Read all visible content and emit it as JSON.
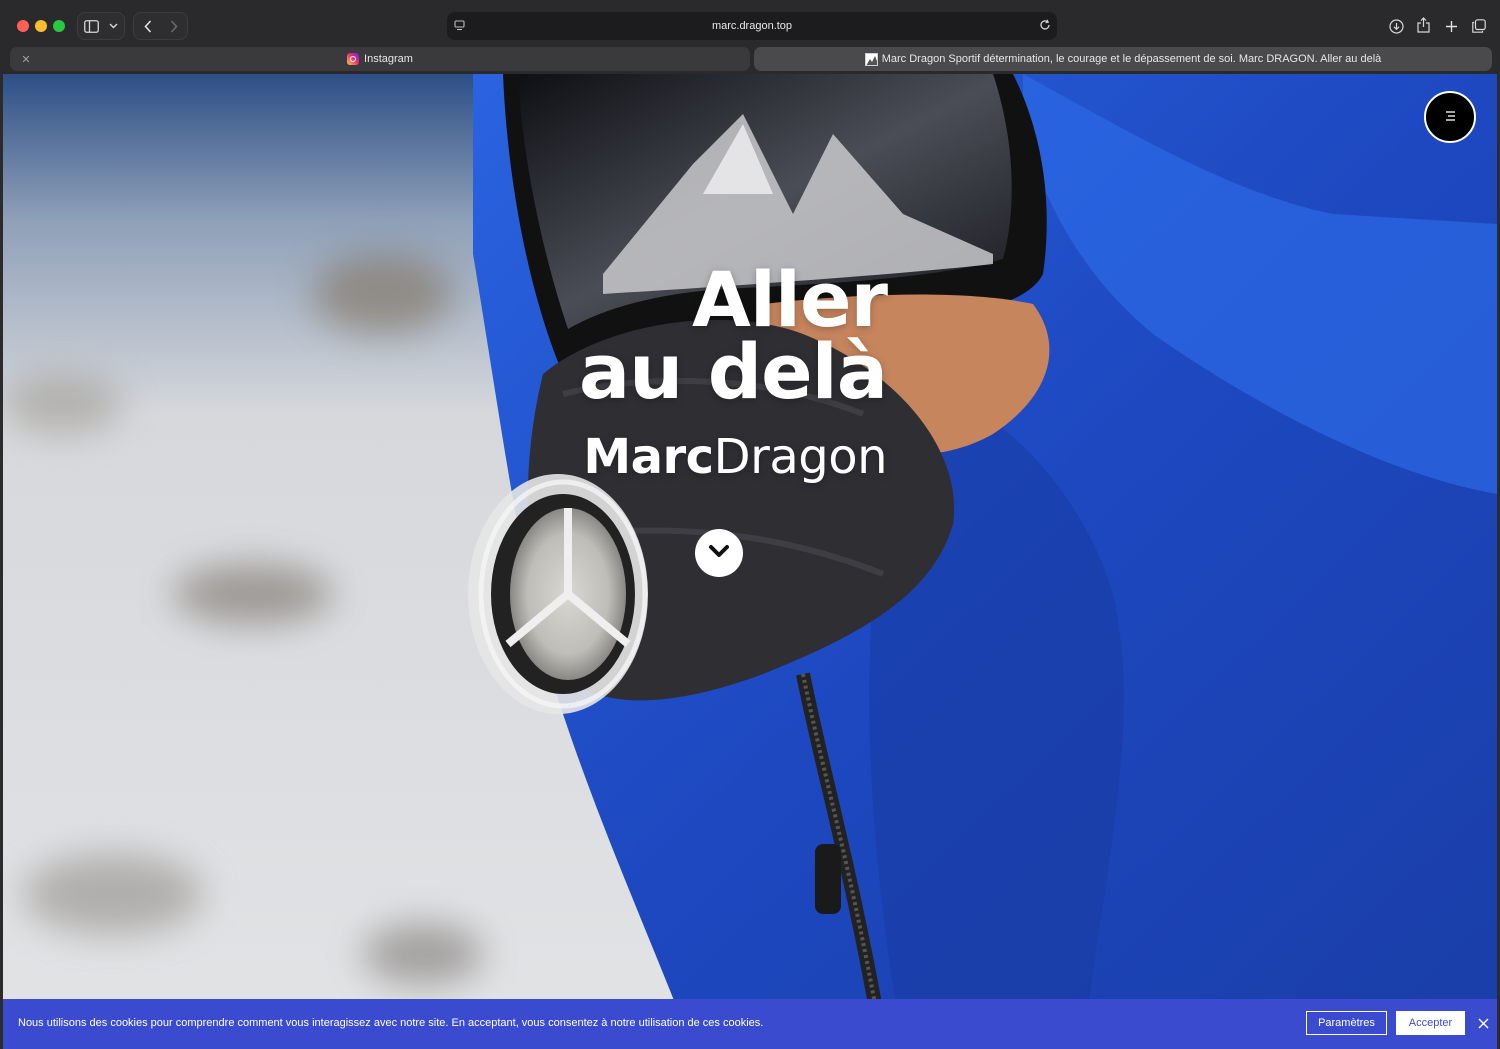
{
  "browser": {
    "address": "marc.dragon.top",
    "tabs": [
      {
        "label": "Instagram",
        "favicon": "instagram-icon"
      },
      {
        "label": "Marc Dragon Sportif détermination, le courage et le dépassement de soi. Marc DRAGON. Aller au delà",
        "favicon": "site-favicon"
      }
    ]
  },
  "hero": {
    "title_line1": "Aller",
    "title_line2": "au delà",
    "brand_bold": "Marc",
    "brand_light": "Dragon"
  },
  "cookie": {
    "text": "Nous utilisons des cookies pour comprendre comment vous interagissez avec notre site. En acceptant, vous consentez à notre utilisation de ces cookies.",
    "settings_label": "Paramètres",
    "accept_label": "Accepter"
  },
  "colors": {
    "cookie_bg": "#3b4bcf",
    "jacket_blue": "#1f4fd0"
  }
}
